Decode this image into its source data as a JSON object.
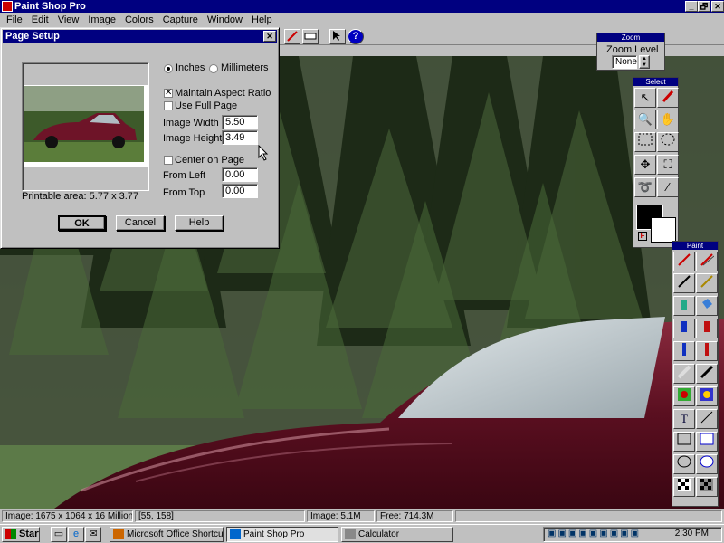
{
  "app": {
    "title": "Paint Shop Pro",
    "window_buttons": {
      "minimize": "_",
      "restore": "🗗",
      "close": "✕"
    }
  },
  "menu": [
    "File",
    "Edit",
    "View",
    "Image",
    "Colors",
    "Capture",
    "Window",
    "Help"
  ],
  "page_setup": {
    "title": "Page Setup",
    "close": "✕",
    "units": {
      "inches": "Inches",
      "millimeters": "Millimeters",
      "selected": "inches"
    },
    "maintain_aspect": "Maintain Aspect Ratio",
    "maintain_aspect_checked": true,
    "use_full_page": "Use Full Page",
    "use_full_page_checked": false,
    "image_width_label": "Image Width",
    "image_width": "5.50",
    "image_height_label": "Image Height",
    "image_height": "3.49",
    "center_on_page": "Center on Page",
    "center_on_page_checked": false,
    "from_left_label": "From Left",
    "from_left": "0.00",
    "from_top_label": "From Top",
    "from_top": "0.00",
    "printable_area": "Printable area:  5.77 x 3.77",
    "ok": "OK",
    "cancel": "Cancel",
    "help": "Help"
  },
  "zoom": {
    "title": "Zoom",
    "label": "Zoom Level",
    "value": "None"
  },
  "select_palette": {
    "title": "Select"
  },
  "paint_palette": {
    "title": "Paint"
  },
  "status": {
    "image_size": "Image: 1675 x 1064 x 16 Million",
    "cursor": "[55, 158]",
    "memory": "Image: 5.1M",
    "free": "Free: 714.3M"
  },
  "taskbar": {
    "start": "Start",
    "items": [
      "Microsoft Office Shortcut ...",
      "Paint Shop Pro",
      "Calculator"
    ],
    "active_item": "Paint Shop Pro",
    "clock": "2:30 PM"
  }
}
